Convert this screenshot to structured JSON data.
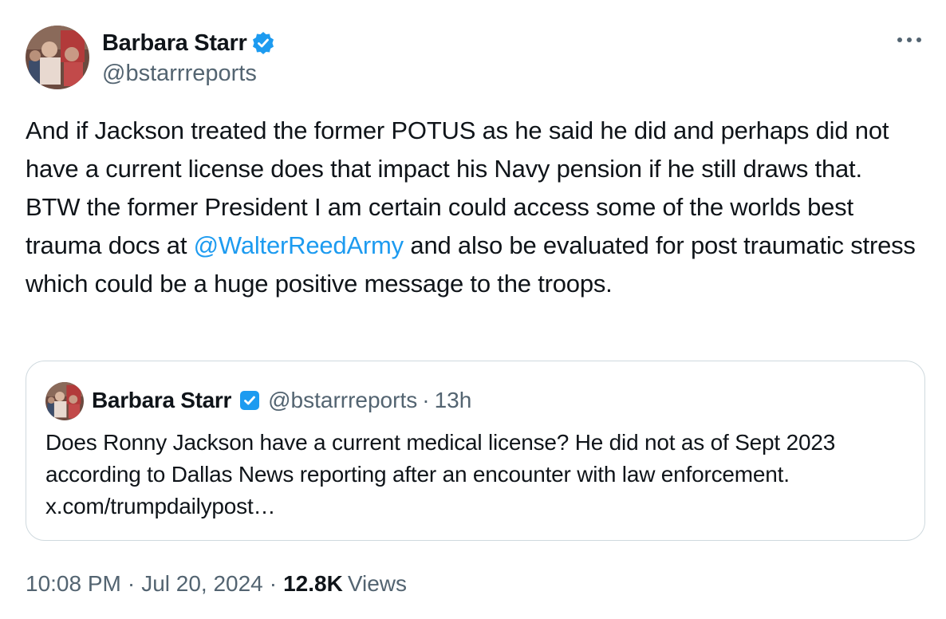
{
  "author": {
    "name": "Barbara Starr",
    "handle": "@bstarrreports",
    "verified": true,
    "verified_color": "#1d9bf0"
  },
  "tweet": {
    "text_before_mention": "And if Jackson treated the former POTUS as he said he did and perhaps did not have a current license does that impact his Navy pension if he still draws that. BTW the former President I am certain could access some of the worlds best trauma docs at ",
    "mention": "@WalterReedArmy",
    "text_after_mention": " and also be evaluated for post traumatic stress which could be a huge positive message to the troops."
  },
  "quoted_tweet": {
    "name": "Barbara Starr",
    "handle": "@bstarrreports",
    "separator": "·",
    "time": "13h",
    "text": "Does Ronny Jackson have a current medical license? He did not as of Sept 2023 according to Dallas News reporting after an encounter with law enforcement. x.com/trumpdailypost…"
  },
  "meta": {
    "time": "10:08 PM",
    "separator": "·",
    "date": "Jul 20, 2024",
    "views_count": "12.8K",
    "views_label": "Views"
  },
  "icons": {
    "more": "more-horizontal-icon",
    "verified": "verified-badge-icon"
  },
  "colors": {
    "text_primary": "#0f1419",
    "text_secondary": "#536471",
    "link": "#1d9bf0",
    "border": "#cfd9de"
  }
}
